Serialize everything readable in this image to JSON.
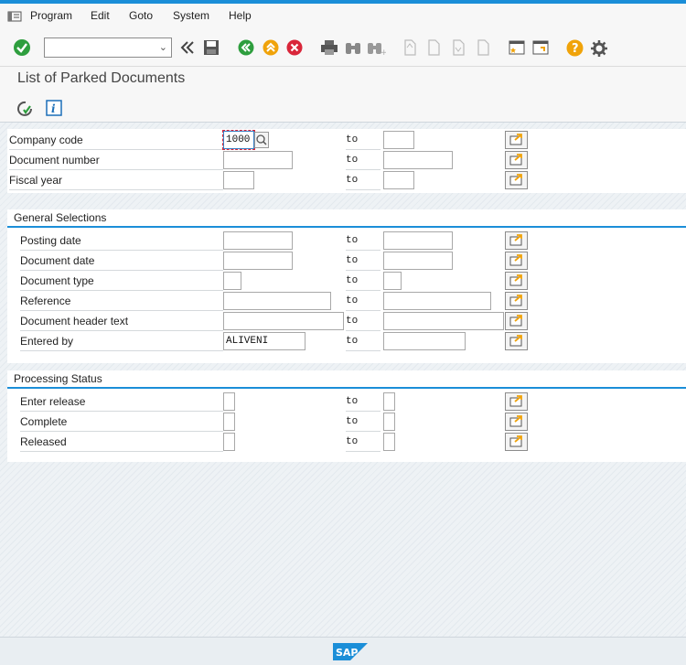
{
  "menu": {
    "items": [
      "Program",
      "Edit",
      "Goto",
      "System",
      "Help"
    ]
  },
  "toolbar": {
    "command_field_value": ""
  },
  "title": "List of Parked Documents",
  "selection": {
    "to_label": "to",
    "rows": [
      {
        "label": "Company code",
        "from": "1000",
        "to": ""
      },
      {
        "label": "Document number",
        "from": "",
        "to": ""
      },
      {
        "label": "Fiscal year",
        "from": "",
        "to": ""
      }
    ]
  },
  "general": {
    "title": "General Selections",
    "rows": [
      {
        "label": "Posting date",
        "from": "",
        "to": ""
      },
      {
        "label": "Document date",
        "from": "",
        "to": ""
      },
      {
        "label": "Document type",
        "from": "",
        "to": ""
      },
      {
        "label": "Reference",
        "from": "",
        "to": ""
      },
      {
        "label": "Document header text",
        "from": "",
        "to": ""
      },
      {
        "label": "Entered by",
        "from": "ALIVENI",
        "to": ""
      }
    ]
  },
  "status": {
    "title": "Processing Status",
    "rows": [
      {
        "label": "Enter release",
        "from": "",
        "to": ""
      },
      {
        "label": "Complete",
        "from": "",
        "to": ""
      },
      {
        "label": "Released",
        "from": "",
        "to": ""
      }
    ]
  },
  "colors": {
    "accent": "#1b8ed8",
    "enter_green": "#2e9e3e",
    "exit_orange": "#f0a30a",
    "cancel_red": "#d9263a",
    "help_yellow": "#f0a30a",
    "sap_blue": "#1b8ed8"
  },
  "icons": [
    "menu-icon",
    "enter-icon",
    "back-icon",
    "save-icon",
    "back-green-icon",
    "exit-icon",
    "cancel-icon",
    "print-icon",
    "find-icon",
    "find-next-icon",
    "first-page-icon",
    "previous-page-icon",
    "next-page-icon",
    "last-page-icon",
    "new-session-icon",
    "shortcut-icon",
    "help-icon",
    "settings-icon",
    "execute-icon",
    "info-icon",
    "multiple-selection-icon",
    "value-help-icon",
    "sap-logo"
  ]
}
